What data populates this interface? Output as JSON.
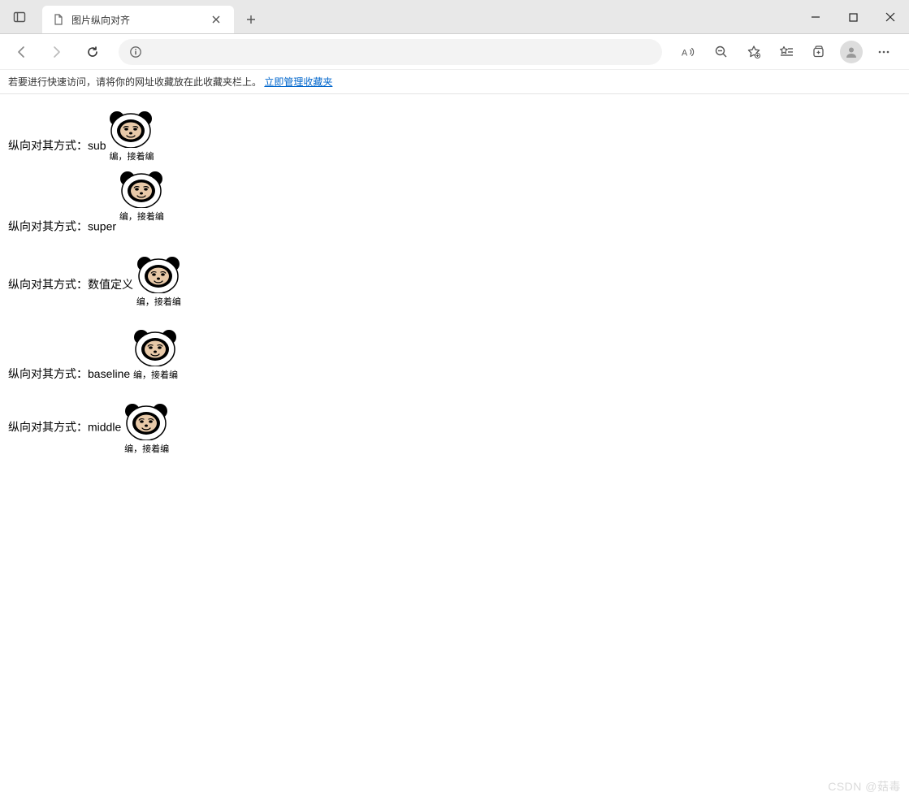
{
  "window": {
    "tab_title": "图片纵向对齐"
  },
  "favbar": {
    "prompt": "若要进行快速访问，请将你的网址收藏放在此收藏夹栏上。",
    "link": "立即管理收藏夹"
  },
  "address": {
    "url": " "
  },
  "rows": [
    {
      "label": "纵向对其方式：sub"
    },
    {
      "label": "纵向对其方式：super"
    },
    {
      "label": "纵向对其方式：数值定义"
    },
    {
      "label": "纵向对其方式：baseline"
    },
    {
      "label": "纵向对其方式：middle"
    }
  ],
  "panda_caption": "编，接着编",
  "watermark": "CSDN @菇毒"
}
